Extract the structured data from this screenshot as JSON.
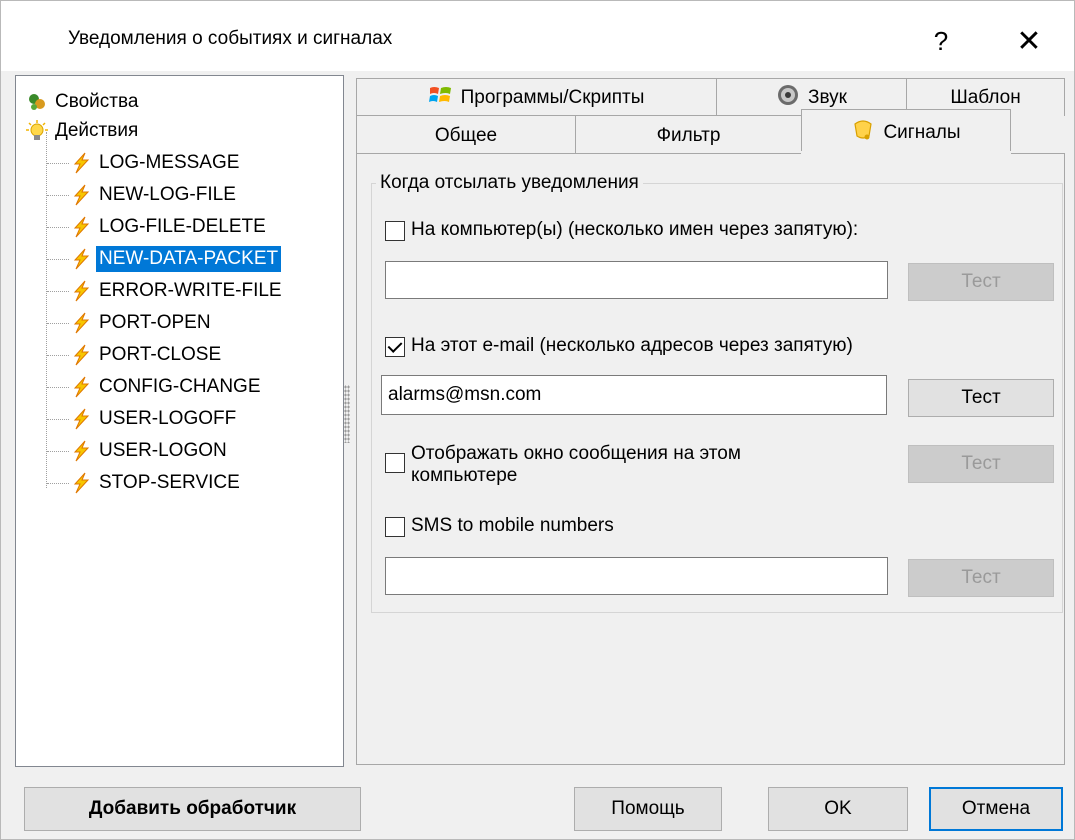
{
  "window": {
    "title": "Уведомления о событиях и сигналах",
    "help_glyph": "?",
    "close_glyph": "✕"
  },
  "tree": {
    "root_items": [
      {
        "label": "Свойства",
        "icon": "properties-icon"
      },
      {
        "label": "Действия",
        "icon": "lightbulb-icon"
      }
    ],
    "actions": [
      {
        "label": "LOG-MESSAGE",
        "icon": "lightning-icon"
      },
      {
        "label": "NEW-LOG-FILE",
        "icon": "lightning-icon"
      },
      {
        "label": "LOG-FILE-DELETE",
        "icon": "lightning-icon"
      },
      {
        "label": "NEW-DATA-PACKET",
        "icon": "lightning-icon",
        "selected": true
      },
      {
        "label": "ERROR-WRITE-FILE",
        "icon": "lightning-icon"
      },
      {
        "label": "PORT-OPEN",
        "icon": "lightning-icon"
      },
      {
        "label": "PORT-CLOSE",
        "icon": "lightning-icon"
      },
      {
        "label": "CONFIG-CHANGE",
        "icon": "lightning-icon"
      },
      {
        "label": "USER-LOGOFF",
        "icon": "lightning-icon"
      },
      {
        "label": "USER-LOGON",
        "icon": "lightning-icon"
      },
      {
        "label": "STOP-SERVICE",
        "icon": "lightning-icon"
      }
    ],
    "selection_color": "#0078d7"
  },
  "tabs": {
    "row1": [
      {
        "label": "Программы/Скрипты",
        "icon": "windows-icon"
      },
      {
        "label": "Звук",
        "icon": "speaker-icon"
      },
      {
        "label": "Шаблон"
      }
    ],
    "row2": [
      {
        "label": "Общее"
      },
      {
        "label": "Фильтр"
      },
      {
        "label": "Сигналы",
        "icon": "bell-icon",
        "active": true
      }
    ]
  },
  "alerts": {
    "group_title": "Когда отсылать уведомления",
    "computers": {
      "label": "На компьютер(ы) (несколько имен через запятую):",
      "checked": false,
      "value": "",
      "test_label": "Тест"
    },
    "email": {
      "label": "На этот e-mail (несколько адресов через запятую)",
      "checked": true,
      "value": "alarms@msn.com",
      "test_label": "Тест"
    },
    "messagebox": {
      "label_line1": "Отображать окно сообщения на этом",
      "label_line2": "компьютере",
      "checked": false,
      "test_label": "Тест"
    },
    "sms": {
      "label": "SMS to mobile numbers",
      "checked": false,
      "value": "",
      "test_label": "Тест"
    }
  },
  "footer": {
    "add_handler": "Добавить обработчик",
    "help": "Помощь",
    "ok": "OK",
    "cancel": "Отмена"
  }
}
